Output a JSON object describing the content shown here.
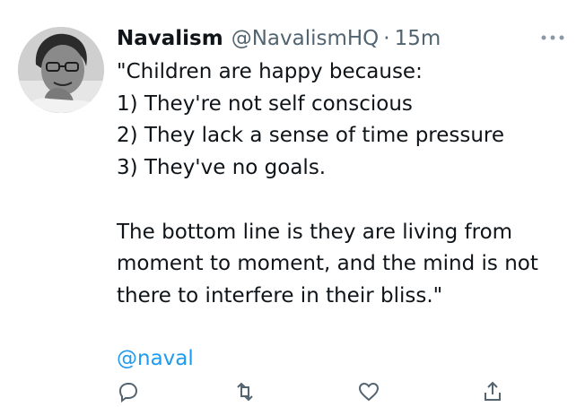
{
  "tweet": {
    "display_name": "Navalism",
    "handle": "@NavalismHQ",
    "separator": "·",
    "time": "15m",
    "lines": [
      "\"Children are happy because:",
      "1) They're not self conscious",
      "2) They lack a sense of time pressure",
      "3) They've no goals.",
      "",
      "The bottom line is they are living from",
      "moment to moment, and the mind is not",
      "there to interfere in their bliss.\""
    ],
    "mention": "@naval"
  },
  "icons": {
    "more": "more-icon",
    "avatar": "avatar",
    "reply": "reply-icon",
    "retweet": "retweet-icon",
    "like": "heart-icon",
    "share": "share-icon"
  },
  "colors": {
    "text": "#0f1419",
    "secondary": "#536471",
    "link": "#1d9bf0"
  }
}
